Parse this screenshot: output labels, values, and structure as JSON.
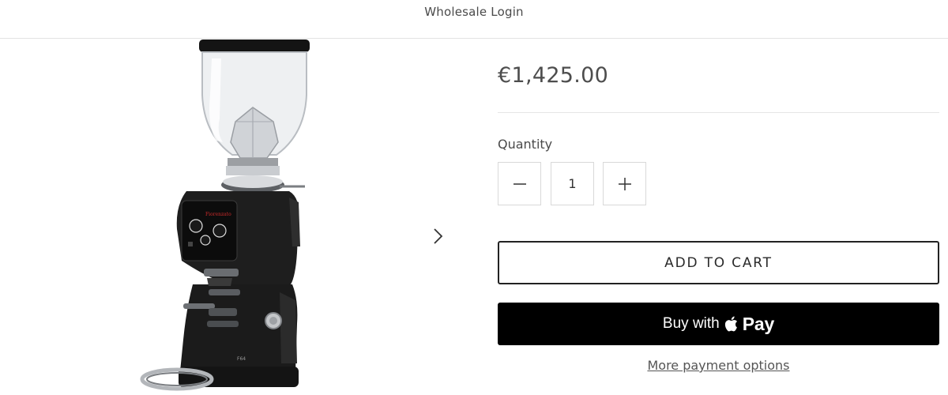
{
  "header": {
    "wholesale_login": "Wholesale Login"
  },
  "product": {
    "price": "€1,425.00",
    "quantity_label": "Quantity",
    "quantity_value": "1",
    "add_to_cart": "ADD TO CART",
    "buy_with": "Buy with",
    "pay_brand": "Pay",
    "more_payment_options": "More payment options"
  },
  "gallery": {
    "image_alt": "Coffee grinder product image",
    "next_icon": "chevron-right-icon"
  },
  "icons": {
    "minus": "minus-icon",
    "plus": "plus-icon",
    "apple": "apple-logo-icon"
  },
  "colors": {
    "buy_button_bg": "#000000",
    "border": "#d9d9d9",
    "text": "#4a4a4a"
  }
}
